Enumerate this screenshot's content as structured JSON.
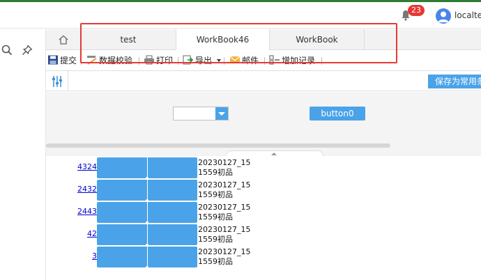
{
  "header": {
    "notification_count": "23",
    "username": "localtes"
  },
  "tabs": [
    {
      "label": "test",
      "active": false
    },
    {
      "label": "WorkBook46",
      "active": true
    },
    {
      "label": "WorkBook",
      "active": false
    }
  ],
  "toolbar": {
    "submit": "提交",
    "validate": "数据校验",
    "print": "打印",
    "export": "导出",
    "mail": "邮件",
    "add_record": "增加记录"
  },
  "subbar": {
    "save_common": "保存为常用条件"
  },
  "form": {
    "select_value": "",
    "button_label": "button0"
  },
  "rows": [
    {
      "num": "4324",
      "line1": "20230127_15",
      "line2": "1559初品"
    },
    {
      "num": "2432",
      "line1": "20230127_15",
      "line2": "1559初品"
    },
    {
      "num": "2443",
      "line1": "20230127_15",
      "line2": "1559初品"
    },
    {
      "num": "42",
      "line1": "20230127_15",
      "line2": "1559初品"
    },
    {
      "num": "3",
      "line1": "20230127_15",
      "line2": "1559初品"
    }
  ],
  "colors": {
    "accent": "#4aa3e8",
    "highlight_box": "#e53935",
    "badge": "#e53935",
    "topline": "#2e7d32"
  }
}
